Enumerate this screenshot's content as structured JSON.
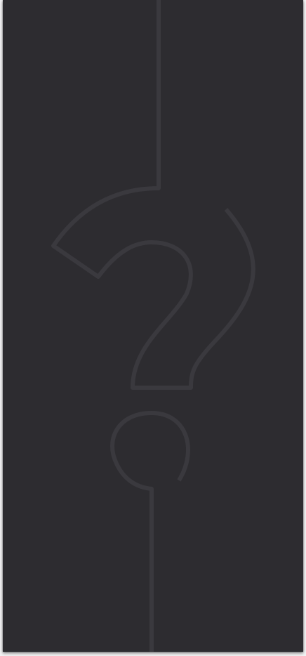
{
  "card": {
    "background_color": "#2d2c30",
    "line_color": "#3a393e",
    "icon": "question-mark-icon"
  }
}
